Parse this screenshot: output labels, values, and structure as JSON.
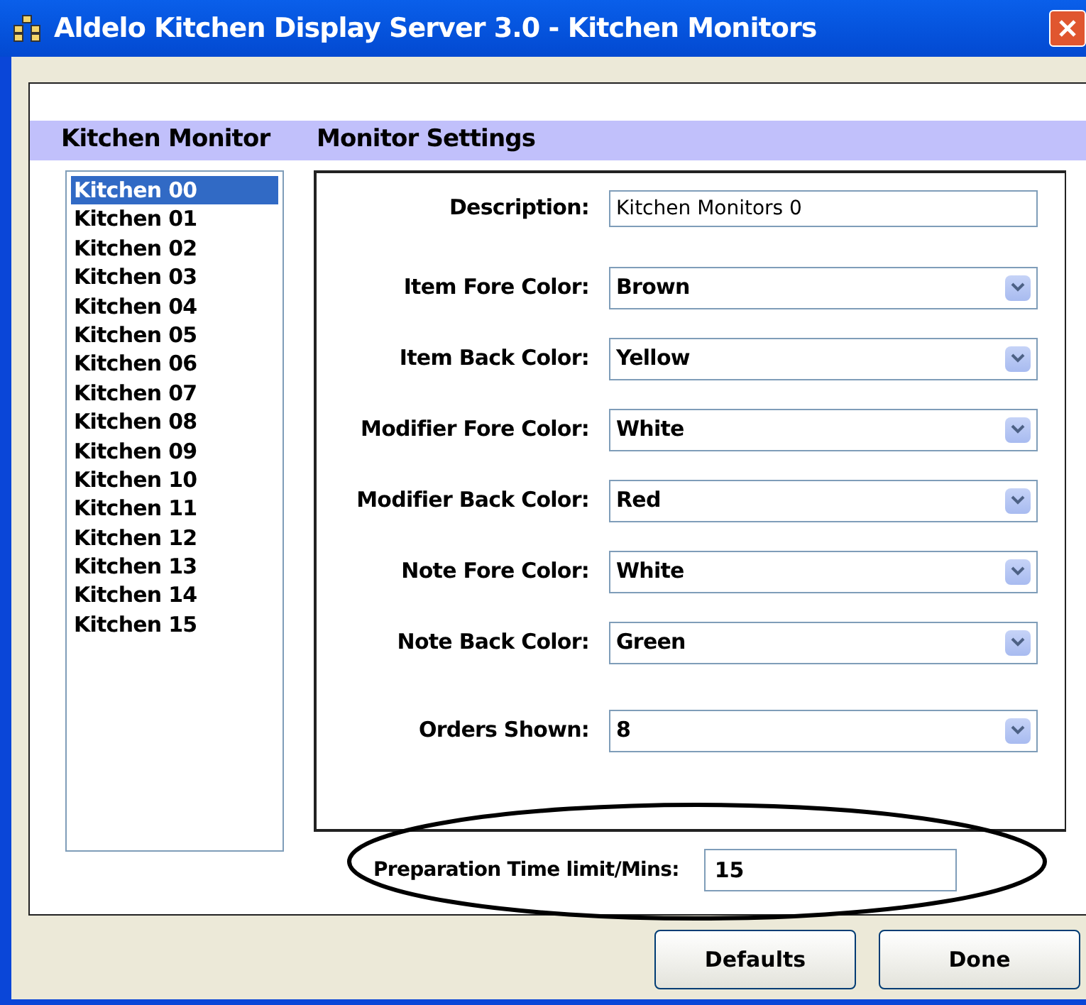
{
  "window": {
    "title": "Aldelo Kitchen Display Server 3.0 - Kitchen Monitors"
  },
  "headers": {
    "list": "Kitchen Monitor",
    "settings": "Monitor Settings"
  },
  "monitors": [
    {
      "label": "Kitchen 00",
      "selected": true
    },
    {
      "label": "Kitchen 01",
      "selected": false
    },
    {
      "label": "Kitchen 02",
      "selected": false
    },
    {
      "label": "Kitchen 03",
      "selected": false
    },
    {
      "label": "Kitchen 04",
      "selected": false
    },
    {
      "label": "Kitchen 05",
      "selected": false
    },
    {
      "label": "Kitchen 06",
      "selected": false
    },
    {
      "label": "Kitchen 07",
      "selected": false
    },
    {
      "label": "Kitchen 08",
      "selected": false
    },
    {
      "label": "Kitchen 09",
      "selected": false
    },
    {
      "label": "Kitchen 10",
      "selected": false
    },
    {
      "label": "Kitchen 11",
      "selected": false
    },
    {
      "label": "Kitchen 12",
      "selected": false
    },
    {
      "label": "Kitchen 13",
      "selected": false
    },
    {
      "label": "Kitchen 14",
      "selected": false
    },
    {
      "label": "Kitchen 15",
      "selected": false
    }
  ],
  "settings": [
    {
      "kind": "text",
      "label": "Description:",
      "value": "Kitchen Monitors 0"
    },
    {
      "kind": "dropdown",
      "label": "Item Fore Color:",
      "value": "Brown"
    },
    {
      "kind": "dropdown",
      "label": "Item Back Color:",
      "value": "Yellow"
    },
    {
      "kind": "dropdown",
      "label": "Modifier Fore Color:",
      "value": "White"
    },
    {
      "kind": "dropdown",
      "label": "Modifier Back Color:",
      "value": "Red"
    },
    {
      "kind": "dropdown",
      "label": "Note Fore Color:",
      "value": "White"
    },
    {
      "kind": "dropdown",
      "label": "Note Back Color:",
      "value": "Green"
    },
    {
      "kind": "dropdown",
      "label": "Orders Shown:",
      "value": "8"
    }
  ],
  "preparation": {
    "label": "Preparation Time limit/Mins:",
    "value": "15"
  },
  "buttons": [
    "Defaults",
    "Done"
  ]
}
